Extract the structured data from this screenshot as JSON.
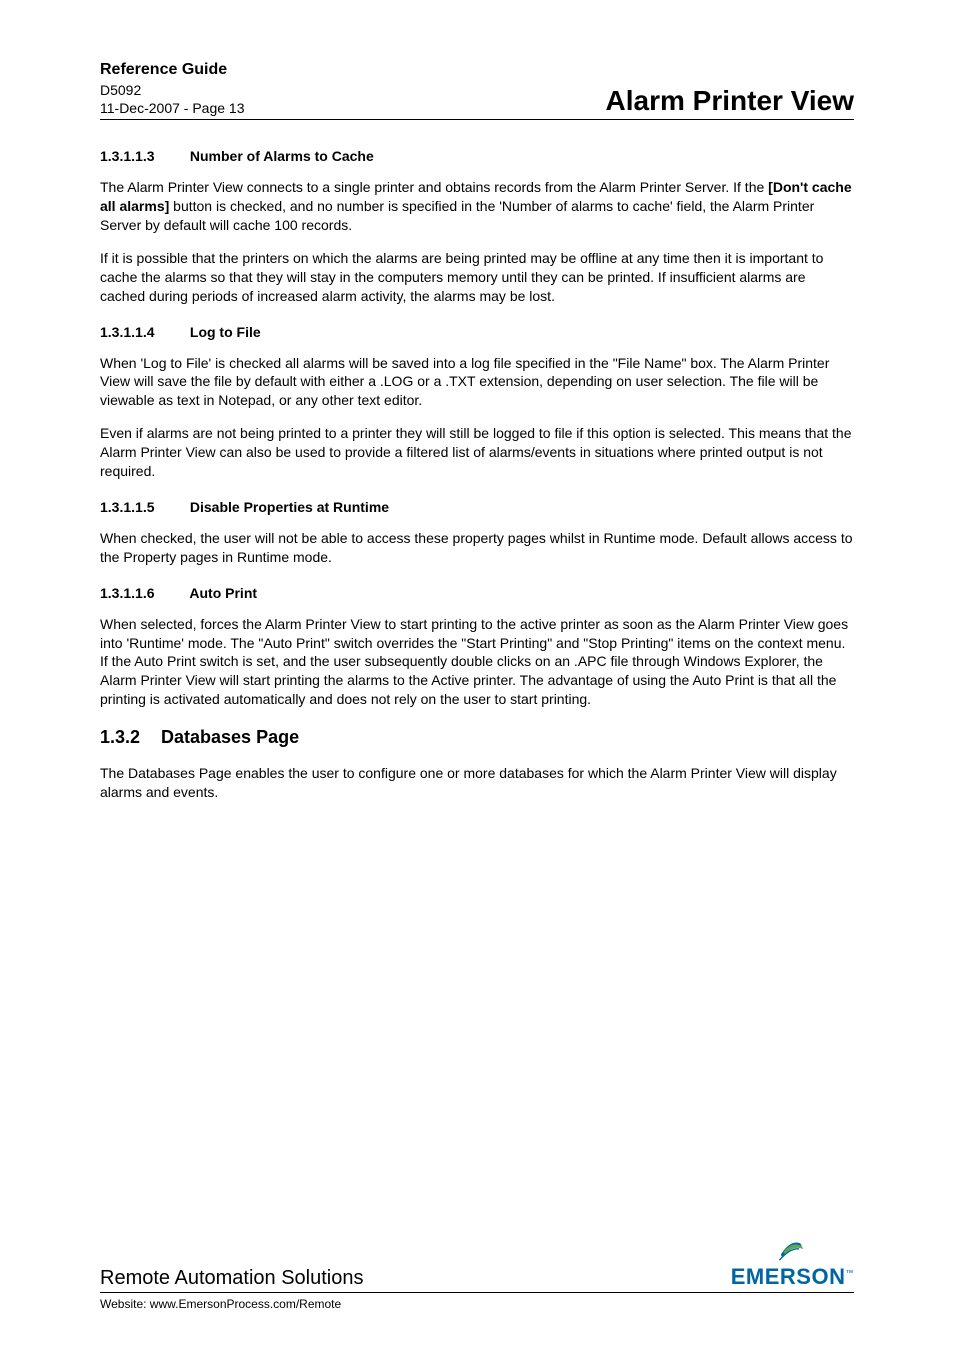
{
  "header": {
    "ref_guide": "Reference Guide",
    "doc_id": "D5092",
    "date_page": "11-Dec-2007 - Page 13",
    "title": "Alarm Printer View"
  },
  "sections": {
    "s1": {
      "num": "1.3.1.1.3",
      "title": "Number of Alarms to Cache",
      "p1a": "The Alarm Printer View connects to a single printer and obtains records from the Alarm Printer Server. If the ",
      "p1b": "[Don't cache all alarms]",
      "p1c": " button is checked, and no number is specified in the 'Number of alarms to cache' field, the Alarm Printer Server by default will cache 100 records.",
      "p2": "If it is possible that the printers on which the alarms are being printed may be offline at any time then it is important to cache the alarms so that they will stay in the computers memory until they can be printed. If insufficient alarms are cached during periods of increased alarm activity, the alarms may be lost."
    },
    "s2": {
      "num": "1.3.1.1.4",
      "title": "Log to File",
      "p1": "When 'Log to File' is checked all alarms will be saved into a log file specified in the \"File Name\" box. The Alarm Printer View will save the file by default with either a .LOG or a .TXT extension, depending on user selection. The file will be viewable as text in Notepad, or any other text editor.",
      "p2": "Even if alarms are not being printed to a printer they will still be logged to file if this option is selected. This means that the Alarm Printer View can also be used to provide a filtered list of alarms/events in situations where printed output is not required."
    },
    "s3": {
      "num": "1.3.1.1.5",
      "title": "Disable Properties at Runtime",
      "p1": "When checked, the user will not be able to access these property pages whilst in Runtime mode. Default allows access to the Property pages in Runtime mode."
    },
    "s4": {
      "num": "1.3.1.1.6",
      "title": "Auto Print",
      "p1": "When selected, forces the Alarm Printer View to start printing to the active printer as soon as the Alarm Printer View goes into 'Runtime' mode. The \"Auto Print\" switch overrides the \"Start Printing\" and \"Stop Printing\" items on the context menu. If the Auto Print switch is set, and the user subsequently double clicks on an .APC file through Windows Explorer, the Alarm Printer View will start printing the alarms to the Active printer. The advantage of using the Auto Print is that all the printing is activated automatically and does not rely on the user to start printing."
    },
    "h2": {
      "num": "1.3.2",
      "title": "Databases Page",
      "p1": "The Databases Page enables the user to configure one or more databases for which the Alarm Printer View will display alarms and events."
    }
  },
  "footer": {
    "company": "Remote Automation Solutions",
    "website": "Website:  www.EmersonProcess.com/Remote",
    "logo_text": "EMERSON",
    "logo_tm": "™"
  }
}
